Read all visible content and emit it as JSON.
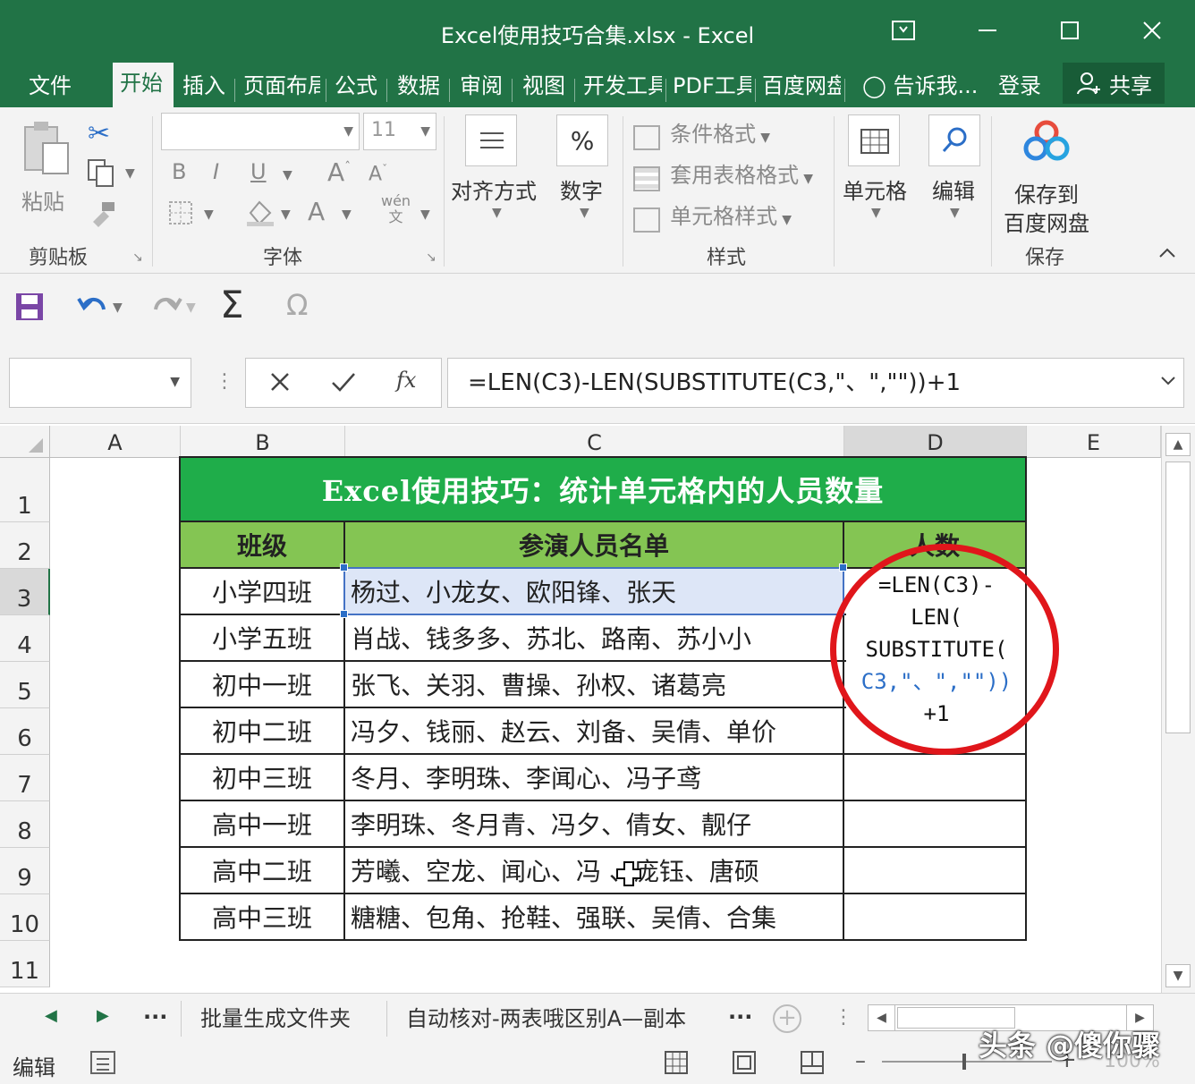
{
  "window": {
    "title": "Excel使用技巧合集.xlsx - Excel"
  },
  "tabs": [
    "文件",
    "开始",
    "插入",
    "页面布局",
    "公式",
    "数据",
    "审阅",
    "视图",
    "开发工具",
    "PDF工具",
    "百度网盘"
  ],
  "tell_me": "告诉我...",
  "login": "登录",
  "share": "共享",
  "ribbon": {
    "clipboard": {
      "paste": "粘贴",
      "label": "剪贴板"
    },
    "font": {
      "size": "11",
      "label": "字体",
      "bold": "B",
      "italic": "I",
      "underline": "U",
      "wen": "wén"
    },
    "alignment": "对齐方式",
    "number": "数字",
    "percent": "%",
    "styles": {
      "conditional": "条件格式",
      "table": "套用表格格式",
      "cell": "单元格样式",
      "label": "样式"
    },
    "cells": "单元格",
    "editing": "编辑",
    "save_to": "保存到",
    "baidu_pan": "百度网盘",
    "save_label": "保存"
  },
  "formula_bar": {
    "name_box": "",
    "formula": "=LEN(C3)-LEN(SUBSTITUTE(C3,\"、\",\"\"))+1",
    "fx": "fx"
  },
  "columns": [
    "A",
    "B",
    "C",
    "D",
    "E"
  ],
  "rows": [
    "1",
    "2",
    "3",
    "4",
    "5",
    "6",
    "7",
    "8",
    "9",
    "10",
    "11"
  ],
  "sheet": {
    "title": "Excel使用技巧：统计单元格内的人员数量",
    "headers": [
      "班级",
      "参演人员名单",
      "人数"
    ],
    "data": [
      [
        "小学四班",
        "杨过、小龙女、欧阳锋、张天"
      ],
      [
        "小学五班",
        "肖战、钱多多、苏北、路南、苏小小"
      ],
      [
        "初中一班",
        "张飞、关羽、曹操、孙权、诸葛亮"
      ],
      [
        "初中二班",
        "冯夕、钱丽、赵云、刘备、吴倩、单价"
      ],
      [
        "初中三班",
        "冬月、李明珠、李闻心、冯子鸢"
      ],
      [
        "高中一班",
        "李明珠、冬月青、冯夕、倩女、靓仔"
      ],
      [
        "高中二班",
        "芳曦、空龙、闻心、冯  、庞钰、唐硕"
      ],
      [
        "高中三班",
        "糖糖、包角、抢鞋、强联、吴倩、合集"
      ]
    ],
    "edit_formula": {
      "l1": "=LEN(C3)-",
      "l2": "LEN(",
      "l3": "SUBSTITUTE(",
      "l4": "C3,\"、\",\"\"))",
      "l5": "+1"
    }
  },
  "sheet_tabs": [
    "批量生成文件夹",
    "自动核对-两表哦区别A—副本"
  ],
  "more": "...",
  "status": {
    "mode": "编辑",
    "zoom": "100%"
  },
  "watermark": "头条 @傻你骤",
  "colors": {
    "excel_green": "#217346",
    "title_fill": "#1fad4a",
    "header_fill": "#84c553",
    "highlight": "#dde6f7",
    "circle": "#e0161b"
  }
}
